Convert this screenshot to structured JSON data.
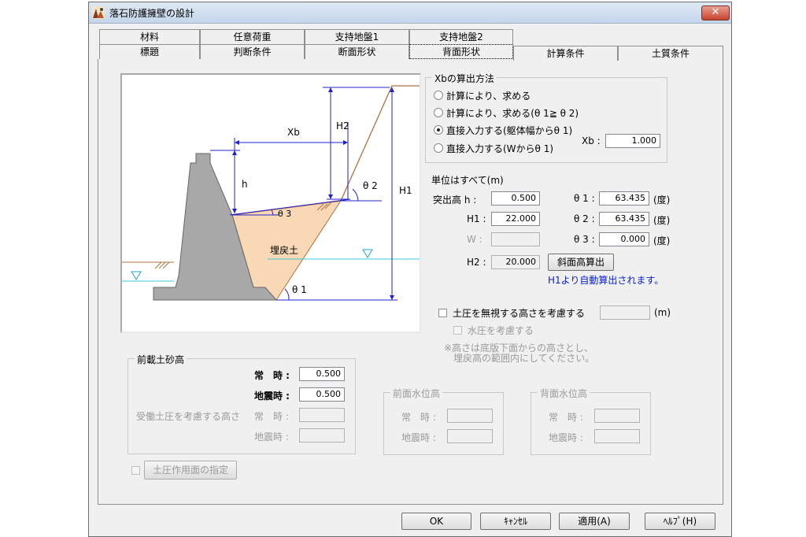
{
  "window": {
    "title": "落石防護擁壁の設計",
    "close_label": "✕"
  },
  "tabs_row1": [
    "材料",
    "任意荷重",
    "支持地盤1",
    "支持地盤2"
  ],
  "tabs_row2": [
    "標題",
    "判断条件",
    "断面形状",
    "背面形状",
    "計算条件",
    "土質条件"
  ],
  "active_tab": "背面形状",
  "diagram": {
    "xb": "Xb",
    "h2": "H2",
    "h1": "H1",
    "h": "h",
    "theta2": "θ 2",
    "theta3": "θ 3",
    "theta1": "θ 1",
    "backfill": "埋戻土"
  },
  "xb_method": {
    "legend": "Xbの算出方法",
    "options": [
      "計算により、求める",
      "計算により、求める(θ 1≧ θ 2)",
      "直接入力する(躯体幅からθ 1)",
      "直接入力する(Wからθ 1)"
    ],
    "selected_index": 2,
    "xb_label": "Xb :",
    "xb_value": "1.000"
  },
  "units_note": "単位はすべて(m)",
  "params": {
    "h_label": "突出高 h :",
    "h_value": "0.500",
    "h1_label": "H1 :",
    "h1_value": "22.000",
    "w_label": "W :",
    "w_value": "",
    "h2_label": "H2 :",
    "h2_value": "20.000",
    "t1_label": "θ 1 :",
    "t1_value": "63.435",
    "t2_label": "θ 2 :",
    "t2_value": "63.435",
    "t3_label": "θ 3 :",
    "t3_value": "0.000",
    "deg_unit": "(度)",
    "calc_button": "斜面高算出",
    "auto_note": "H1より自動算出されます。"
  },
  "earth_pressure": {
    "ignore_label": "土圧を無視する高さを考慮する",
    "ignore_value": "",
    "unit": "(m)",
    "water_label": "水圧を考慮する",
    "note_line1": "※高さは底版下面からの高さとし、",
    "note_line2": "埋戻高の範囲内にしてください。"
  },
  "front_soil": {
    "legend": "前載土砂高",
    "normal_label": "常　時 :",
    "normal_value": "0.500",
    "quake_label": "地震時 :",
    "quake_value": "0.500",
    "passive_label": "受働土圧を考慮する高さ",
    "p_normal_label": "常　時 :",
    "p_normal_value": "",
    "p_quake_label": "地震時 :",
    "p_quake_value": ""
  },
  "front_water": {
    "legend": "前面水位高",
    "normal_label": "常　時 :",
    "normal_value": "",
    "quake_label": "地震時 :",
    "quake_value": ""
  },
  "back_water": {
    "legend": "背面水位高",
    "normal_label": "常　時 :",
    "normal_value": "",
    "quake_label": "地震時 :",
    "quake_value": ""
  },
  "surface_button": "土圧作用面の指定",
  "footer": {
    "ok": "OK",
    "cancel": "ｷｬﾝｾﾙ",
    "apply": "適用(A)",
    "help": "ﾍﾙﾌﾟ(H)"
  }
}
